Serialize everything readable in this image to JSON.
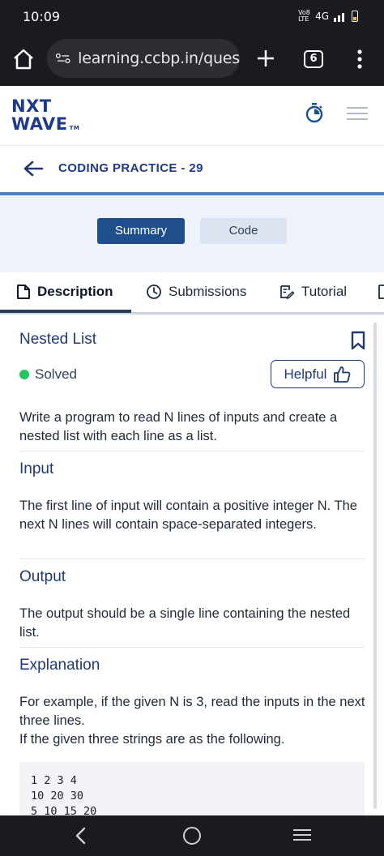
{
  "status_bar": {
    "time": "10:09",
    "network_label": "Vo8 LTE",
    "signal_label": "4G"
  },
  "browser": {
    "url": "learning.ccbp.in/ques",
    "tab_count": "6"
  },
  "site": {
    "logo_line1": "NXT",
    "logo_line2": "WAVE",
    "logo_tm": "TM"
  },
  "practice": {
    "title": "CODING PRACTICE - 29"
  },
  "toggle": {
    "summary_label": "Summary",
    "code_label": "Code"
  },
  "tabs": [
    {
      "label": "Description",
      "active": true
    },
    {
      "label": "Submissions",
      "active": false
    },
    {
      "label": "Tutorial",
      "active": false
    }
  ],
  "problem": {
    "title": "Nested List",
    "status": "Solved",
    "helpful_label": "Helpful",
    "intro": "Write a program to read N lines of inputs and create a nested list with each line as a list.",
    "sections": {
      "input_head": "Input",
      "input_text": "The first line of input will contain a positive integer N. The next N lines will contain space-separated integers.",
      "output_head": "Output",
      "output_text": "The output should be a single line containing the nested list.",
      "explanation_head": "Explanation",
      "explanation_text_1": "For example, if the given N is 3, read the inputs in the next three lines.",
      "explanation_text_2": "If the given three strings are as the following."
    },
    "example_lines": [
      "1 2 3 4",
      "10 20 30",
      "5 10 15 20"
    ]
  },
  "colors": {
    "brand_blue": "#1e3a8a",
    "active_button": "#1e4f8c",
    "solved_green": "#22c55e",
    "heading_blue": "#1e3a6e"
  }
}
